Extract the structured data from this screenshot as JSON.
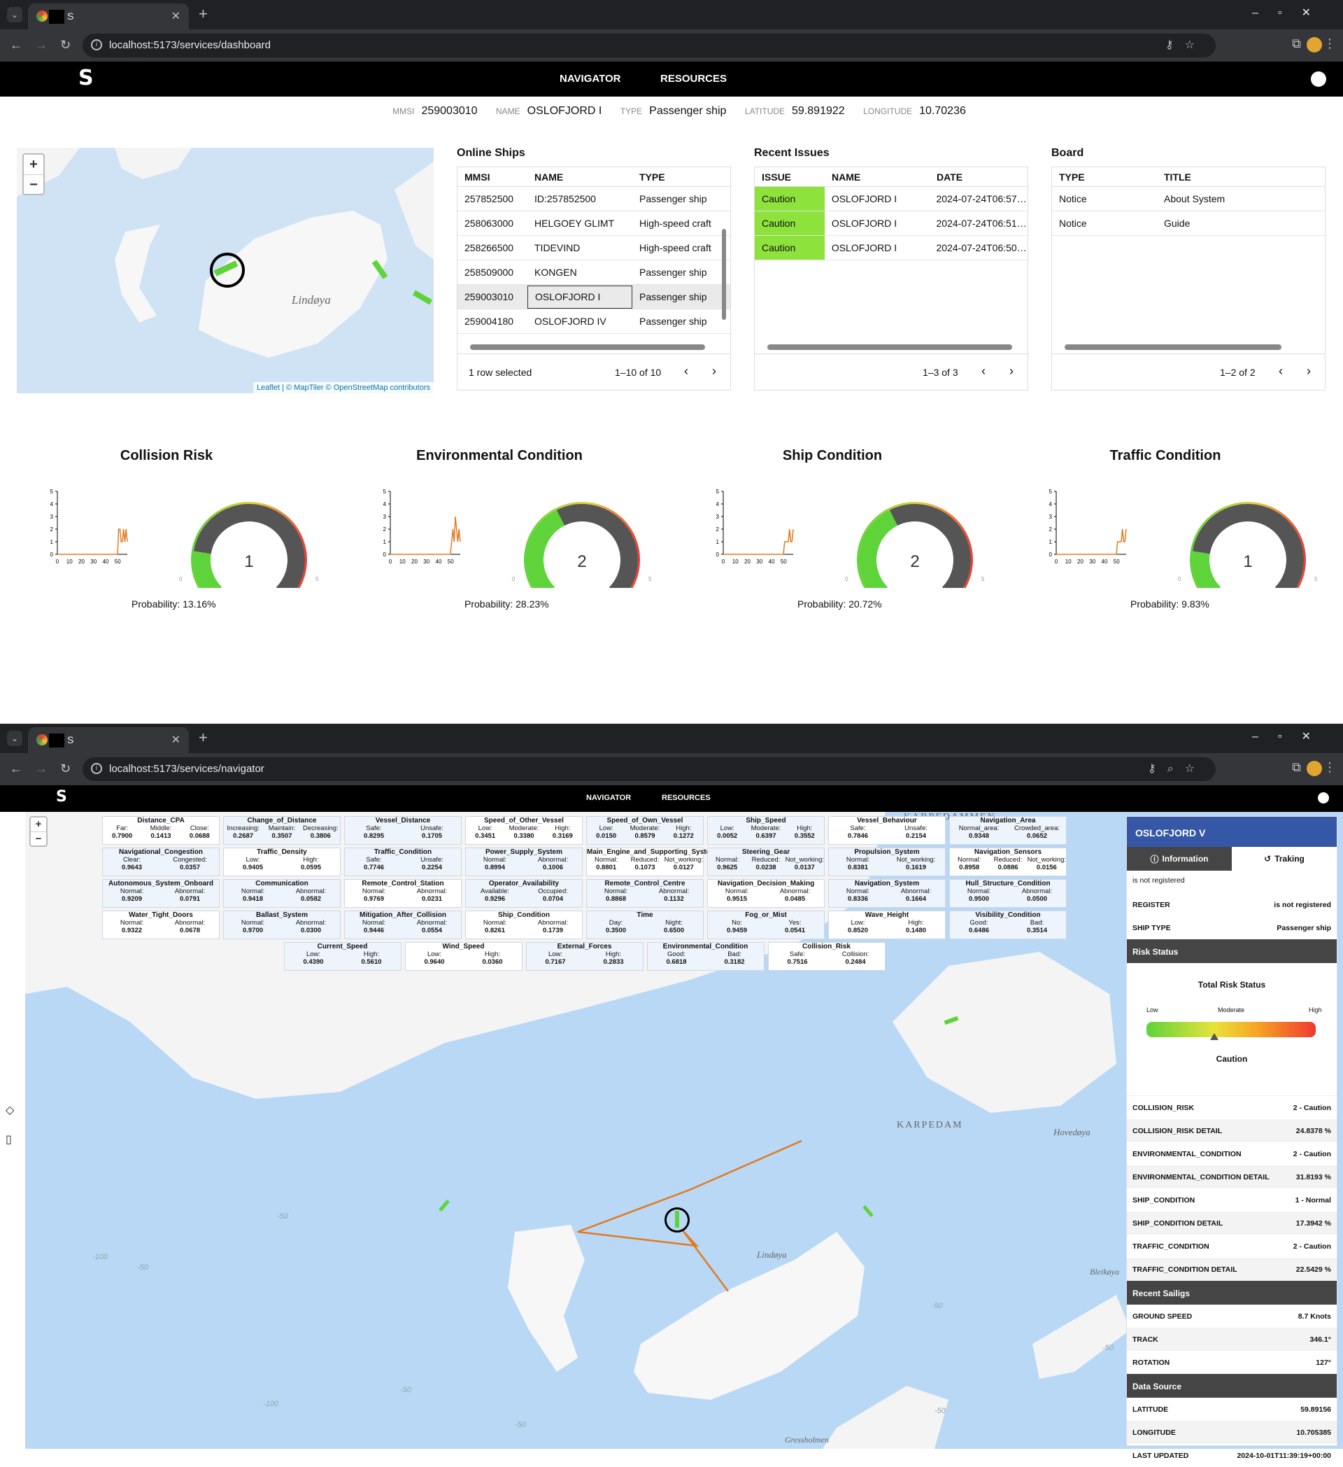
{
  "browser1": {
    "tab_title": "S",
    "url": "localhost:5173/services/dashboard"
  },
  "browser2": {
    "tab_title": "S",
    "url": "localhost:5173/services/navigator"
  },
  "app": {
    "logo": "S",
    "nav": [
      "NAVIGATOR",
      "RESOURCES"
    ]
  },
  "info": {
    "mmsi_label": "MMSI",
    "mmsi": "259003010",
    "name_label": "NAME",
    "name": "OSLOFJORD I",
    "type_label": "TYPE",
    "type": "Passenger ship",
    "lat_label": "LATITUDE",
    "lat": "59.891922",
    "lon_label": "LONGITUDE",
    "lon": "10.70236"
  },
  "map1": {
    "place": "Lindøya",
    "attribution": "Leaflet | © MapTiler © OpenStreetMap contributors",
    "zoom_in": "+",
    "zoom_out": "−"
  },
  "online": {
    "title": "Online Ships",
    "cols": [
      "MMSI",
      "NAME",
      "TYPE"
    ],
    "rows": [
      [
        "257852500",
        "ID:257852500",
        "Passenger ship"
      ],
      [
        "258063000",
        "HELGOEY GLIMT",
        "High-speed craft"
      ],
      [
        "258266500",
        "TIDEVIND",
        "High-speed craft"
      ],
      [
        "258509000",
        "KONGEN",
        "Passenger ship"
      ],
      [
        "259003010",
        "OSLOFJORD I",
        "Passenger ship"
      ],
      [
        "259004180",
        "OSLOFJORD IV",
        "Passenger ship"
      ]
    ],
    "selected": "1 row selected",
    "range": "1–10 of 10"
  },
  "issues": {
    "title": "Recent Issues",
    "cols": [
      "ISSUE",
      "NAME",
      "DATE"
    ],
    "rows": [
      [
        "Caution",
        "OSLOFJORD I",
        "2024-07-24T06:57:..."
      ],
      [
        "Caution",
        "OSLOFJORD I",
        "2024-07-24T06:51:..."
      ],
      [
        "Caution",
        "OSLOFJORD I",
        "2024-07-24T06:50:..."
      ]
    ],
    "range": "1–3 of 3"
  },
  "board": {
    "title": "Board",
    "cols": [
      "TYPE",
      "TITLE"
    ],
    "rows": [
      [
        "Notice",
        "About System"
      ],
      [
        "Notice",
        "Guide"
      ]
    ],
    "range": "1–2 of 2"
  },
  "gauges": [
    {
      "title": "Collision Risk",
      "value": "1",
      "prob": "Probability: 13.16%",
      "level": 1,
      "series": [
        0,
        0,
        0,
        0,
        0,
        0,
        0,
        0,
        0,
        0,
        0,
        0,
        0,
        0,
        0,
        0,
        0,
        0,
        0,
        0,
        0,
        0,
        0,
        0,
        0,
        0,
        0,
        0,
        0,
        0,
        0,
        0,
        0,
        0,
        0,
        0,
        0,
        0,
        0,
        0,
        0,
        0,
        0,
        0,
        0,
        0,
        0,
        0,
        0,
        0,
        2,
        2,
        1,
        1,
        2,
        1,
        2,
        1
      ]
    },
    {
      "title": "Environmental Condition",
      "value": "2",
      "prob": "Probability: 28.23%",
      "level": 2,
      "series": [
        0,
        0,
        0,
        0,
        0,
        0,
        0,
        0,
        0,
        0,
        0,
        0,
        0,
        0,
        0,
        0,
        0,
        0,
        0,
        0,
        0,
        0,
        0,
        0,
        0,
        0,
        0,
        0,
        0,
        0,
        0,
        0,
        0,
        0,
        0,
        0,
        0,
        0,
        0,
        0,
        0,
        0,
        0,
        0,
        0,
        0,
        0,
        0,
        0,
        0,
        1,
        2,
        1,
        3,
        2,
        1,
        2,
        1
      ]
    },
    {
      "title": "Ship Condition",
      "value": "2",
      "prob": "Probability: 20.72%",
      "level": 2,
      "series": [
        0,
        0,
        0,
        0,
        0,
        0,
        0,
        0,
        0,
        0,
        0,
        0,
        0,
        0,
        0,
        0,
        0,
        0,
        0,
        0,
        0,
        0,
        0,
        0,
        0,
        0,
        0,
        0,
        0,
        0,
        0,
        0,
        0,
        0,
        0,
        0,
        0,
        0,
        0,
        0,
        0,
        0,
        0,
        0,
        0,
        0,
        0,
        0,
        0,
        0,
        1,
        1,
        1,
        1,
        2,
        1,
        1,
        2
      ]
    },
    {
      "title": "Traffic Condition",
      "value": "1",
      "prob": "Probability: 9.83%",
      "level": 1,
      "series": [
        0,
        0,
        0,
        0,
        0,
        0,
        0,
        0,
        0,
        0,
        0,
        0,
        0,
        0,
        0,
        0,
        0,
        0,
        0,
        0,
        0,
        0,
        0,
        0,
        0,
        0,
        0,
        0,
        0,
        0,
        0,
        0,
        0,
        0,
        0,
        0,
        0,
        0,
        0,
        0,
        0,
        0,
        0,
        0,
        0,
        0,
        0,
        0,
        0,
        0,
        1,
        1,
        1,
        1,
        2,
        1,
        1,
        2
      ]
    }
  ],
  "gauge_axis": {
    "y_ticks": [
      "0",
      "1",
      "2",
      "3",
      "4",
      "5"
    ],
    "x_ticks": [
      "0",
      "10",
      "20",
      "30",
      "40",
      "50"
    ],
    "min": "0",
    "max": "5"
  },
  "nodes": [
    {
      "t": "Distance_CPA",
      "k": [
        "Far:",
        "Middle:",
        "Close:"
      ],
      "v": [
        "0.7900",
        "0.1413",
        "0.0688"
      ]
    },
    {
      "t": "Change_of_Distance",
      "k": [
        "Increasing:",
        "Maintain:",
        "Decreasing:"
      ],
      "v": [
        "0.2687",
        "0.3507",
        "0.3806"
      ]
    },
    {
      "t": "Vessel_Distance",
      "k": [
        "Safe:",
        "Unsafe:"
      ],
      "v": [
        "0.8295",
        "0.1705"
      ]
    },
    {
      "t": "Speed_of_Other_Vessel",
      "k": [
        "Low:",
        "Moderate:",
        "High:"
      ],
      "v": [
        "0.3451",
        "0.3380",
        "0.3169"
      ]
    },
    {
      "t": "Speed_of_Own_Vessel",
      "k": [
        "Low:",
        "Moderate:",
        "High:"
      ],
      "v": [
        "0.0150",
        "0.8579",
        "0.1272"
      ]
    },
    {
      "t": "Ship_Speed",
      "k": [
        "Low:",
        "Moderate:",
        "High:"
      ],
      "v": [
        "0.0052",
        "0.6397",
        "0.3552"
      ]
    },
    {
      "t": "Vessel_Behaviour",
      "k": [
        "Safe:",
        "Unsafe:"
      ],
      "v": [
        "0.7846",
        "0.2154"
      ]
    },
    {
      "t": "Navigation_Area",
      "k": [
        "Normal_area:",
        "Crowded_area:"
      ],
      "v": [
        "0.9348",
        "0.0652"
      ]
    },
    {
      "t": "Navigational_Congestion",
      "k": [
        "Clear:",
        "Congested:"
      ],
      "v": [
        "0.9643",
        "0.0357"
      ]
    },
    {
      "t": "Traffic_Density",
      "k": [
        "Low:",
        "High:"
      ],
      "v": [
        "0.9405",
        "0.0595"
      ]
    },
    {
      "t": "Traffic_Condition",
      "k": [
        "Safe:",
        "Unsafe:"
      ],
      "v": [
        "0.7746",
        "0.2254"
      ]
    },
    {
      "t": "Power_Supply_System",
      "k": [
        "Normal:",
        "Abnormal:"
      ],
      "v": [
        "0.8994",
        "0.1006"
      ]
    },
    {
      "t": "Main_Engine_and_Supporting_System",
      "k": [
        "Normal:",
        "Reduced:",
        "Not_working:"
      ],
      "v": [
        "0.8801",
        "0.1073",
        "0.0127"
      ]
    },
    {
      "t": "Steering_Gear",
      "k": [
        "Normal:",
        "Reduced:",
        "Not_working:"
      ],
      "v": [
        "0.9625",
        "0.0238",
        "0.0137"
      ]
    },
    {
      "t": "Propulsion_System",
      "k": [
        "Normal:",
        "Not_working:"
      ],
      "v": [
        "0.8381",
        "0.1619"
      ]
    },
    {
      "t": "Navigation_Sensors",
      "k": [
        "Normal:",
        "Reduced:",
        "Not_working:"
      ],
      "v": [
        "0.8958",
        "0.0886",
        "0.0156"
      ]
    },
    {
      "t": "Autonomous_System_Onboard",
      "k": [
        "Normal:",
        "Abnormal:"
      ],
      "v": [
        "0.9209",
        "0.0791"
      ]
    },
    {
      "t": "Communication",
      "k": [
        "Normal:",
        "Abnormal:"
      ],
      "v": [
        "0.9418",
        "0.0582"
      ]
    },
    {
      "t": "Remote_Control_Station",
      "k": [
        "Normal:",
        "Abnormal:"
      ],
      "v": [
        "0.9769",
        "0.0231"
      ]
    },
    {
      "t": "Operator_Availability",
      "k": [
        "Available:",
        "Occupied:"
      ],
      "v": [
        "0.9296",
        "0.0704"
      ]
    },
    {
      "t": "Remote_Control_Centre",
      "k": [
        "Normal:",
        "Abnormal:"
      ],
      "v": [
        "0.8868",
        "0.1132"
      ]
    },
    {
      "t": "Navigation_Decision_Making",
      "k": [
        "Normal:",
        "Abnormal:"
      ],
      "v": [
        "0.9515",
        "0.0485"
      ]
    },
    {
      "t": "Navigation_System",
      "k": [
        "Normal:",
        "Abnormal:"
      ],
      "v": [
        "0.8336",
        "0.1664"
      ]
    },
    {
      "t": "Hull_Structure_Condition",
      "k": [
        "Normal:",
        "Abnormal:"
      ],
      "v": [
        "0.9500",
        "0.0500"
      ]
    },
    {
      "t": "Water_Tight_Doors",
      "k": [
        "Normal:",
        "Abnormal:"
      ],
      "v": [
        "0.9322",
        "0.0678"
      ]
    },
    {
      "t": "Ballast_System",
      "k": [
        "Normal:",
        "Abnormal:"
      ],
      "v": [
        "0.9700",
        "0.0300"
      ]
    },
    {
      "t": "Mitigation_After_Collision",
      "k": [
        "Normal:",
        "Abnormal:"
      ],
      "v": [
        "0.9446",
        "0.0554"
      ]
    },
    {
      "t": "Ship_Condition",
      "k": [
        "Normal:",
        "Abnormal:"
      ],
      "v": [
        "0.8261",
        "0.1739"
      ]
    },
    {
      "t": "Time",
      "k": [
        "Day:",
        "Night:"
      ],
      "v": [
        "0.3500",
        "0.6500"
      ]
    },
    {
      "t": "Fog_or_Mist",
      "k": [
        "No:",
        "Yes:"
      ],
      "v": [
        "0.9459",
        "0.0541"
      ]
    },
    {
      "t": "Wave_Height",
      "k": [
        "Low:",
        "High:"
      ],
      "v": [
        "0.8520",
        "0.1480"
      ]
    },
    {
      "t": "Visibility_Condition",
      "k": [
        "Good:",
        "Bad:"
      ],
      "v": [
        "0.6486",
        "0.3514"
      ]
    },
    {
      "t": "Current_Speed",
      "k": [
        "Low:",
        "High:"
      ],
      "v": [
        "0.4390",
        "0.5610"
      ]
    },
    {
      "t": "Wind_Speed",
      "k": [
        "Low:",
        "High:"
      ],
      "v": [
        "0.9640",
        "0.0360"
      ]
    },
    {
      "t": "External_Forces",
      "k": [
        "Low:",
        "High:"
      ],
      "v": [
        "0.7167",
        "0.2833"
      ]
    },
    {
      "t": "Environmental_Condition",
      "k": [
        "Good:",
        "Bad:"
      ],
      "v": [
        "0.6818",
        "0.3182"
      ]
    },
    {
      "t": "Collision_Risk",
      "k": [
        "Safe:",
        "Collision:"
      ],
      "v": [
        "0.7516",
        "0.2484"
      ]
    }
  ],
  "map2": {
    "labels": [
      "KARPEDAMMEN",
      "KARPEDAM",
      "Hovedøya",
      "Lindøya",
      "Bleikøya",
      "Gressholmen"
    ],
    "depths": [
      "-50",
      "-100",
      "-50",
      "-50",
      "-100",
      "-50",
      "-50",
      "-50",
      "-50"
    ]
  },
  "side": {
    "title": "OSLOFJORD V",
    "tab_info": "Information",
    "tab_track": "Traking",
    "not_reg": "is not registered",
    "register_label": "REGISTER",
    "register": "is not registered",
    "shiptype_label": "SHIP TYPE",
    "shiptype": "Passenger ship",
    "risk_sec": "Risk Status",
    "total": "Total Risk Status",
    "low": "Low",
    "moderate": "Moderate",
    "high": "High",
    "status": "Caution",
    "risk_level": 0.4,
    "risk_rows": [
      [
        "COLLISION_RISK",
        "2 - Caution"
      ],
      [
        "COLLISION_RISK DETAIL",
        "24.8378 %"
      ],
      [
        "ENVIRONMENTAL_CONDITION",
        "2 - Caution"
      ],
      [
        "ENVIRONMENTAL_CONDITION DETAIL",
        "31.8193 %"
      ],
      [
        "SHIP_CONDITION",
        "1 - Normal"
      ],
      [
        "SHIP_CONDITION DETAIL",
        "17.3942 %"
      ],
      [
        "TRAFFIC_CONDITION",
        "2 - Caution"
      ],
      [
        "TRAFFIC_CONDITION DETAIL",
        "22.5429 %"
      ]
    ],
    "sail_sec": "Recent Sailigs",
    "sail_rows": [
      [
        "GROUND SPEED",
        "8.7 Knots"
      ],
      [
        "TRACK",
        "346.1°"
      ],
      [
        "ROTATION",
        "127°"
      ]
    ],
    "src_sec": "Data Source",
    "src_rows": [
      [
        "LATITUDE",
        "59.89156"
      ],
      [
        "LONGITUDE",
        "10.705385"
      ],
      [
        "LAST UPDATED",
        "2024-10-01T11:39:19+00:00"
      ]
    ]
  },
  "colors": {
    "green": "#8de23c",
    "gaugeGreen": "#5ed33a",
    "orange": "#e07b20",
    "navy": "#3557a6"
  }
}
